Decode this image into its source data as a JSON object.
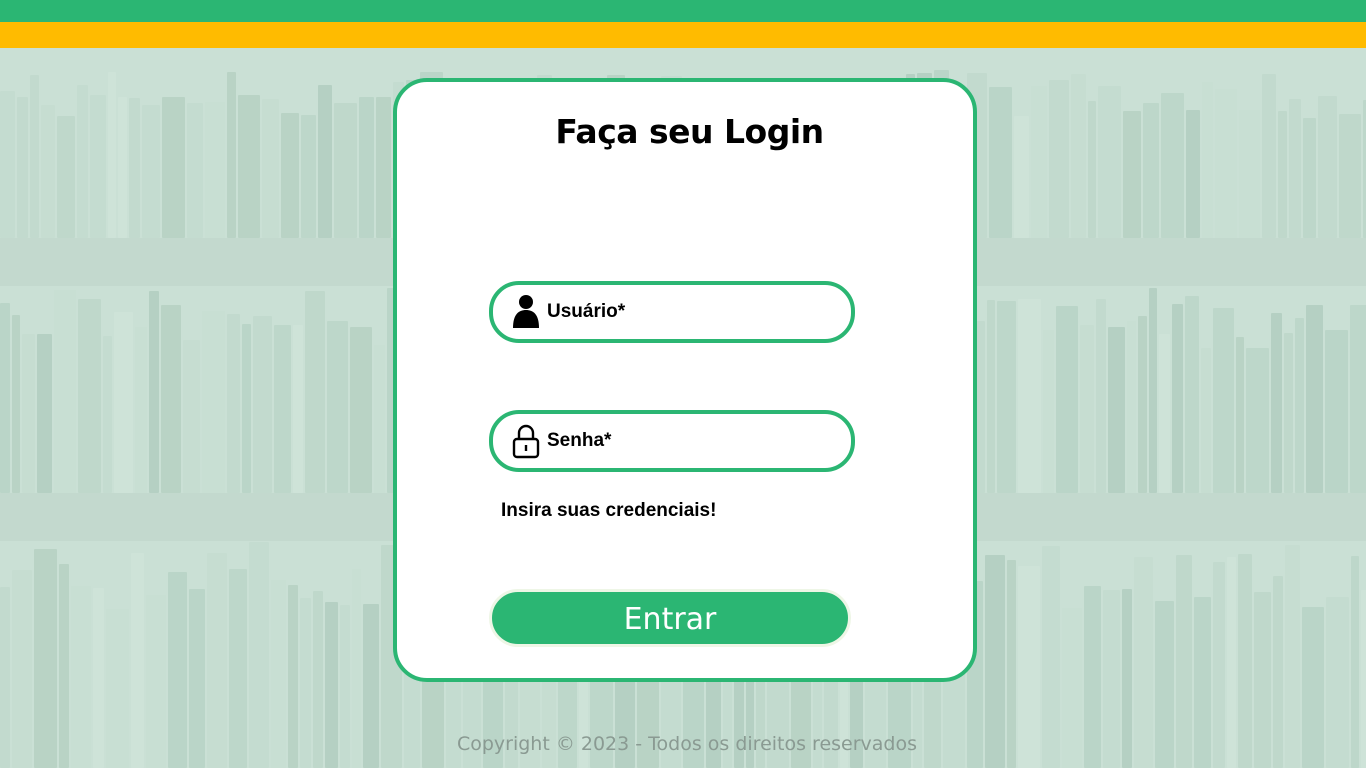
{
  "header": {
    "primary_color": "#2bb673",
    "secondary_color": "#ffbb00"
  },
  "login": {
    "title": "Faça seu Login",
    "username_placeholder": "Usuário*",
    "username_icon": "user-icon",
    "password_placeholder": "Senha*",
    "password_icon": "lock-icon",
    "hint": "Insira suas credenciais!",
    "submit_label": "Entrar"
  },
  "footer": {
    "copyright": "Copyright © 2023 - Todos os direitos reservados"
  }
}
